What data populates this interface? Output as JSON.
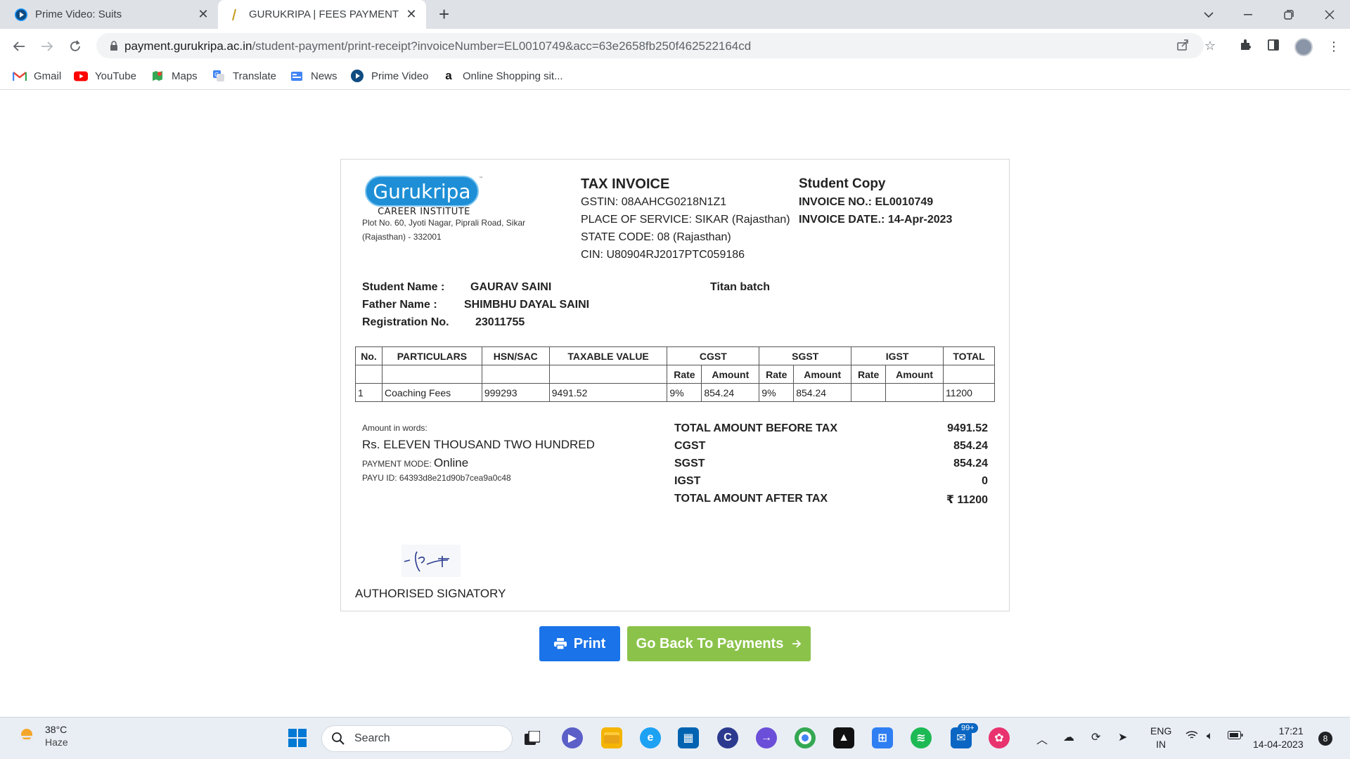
{
  "tabs": [
    {
      "title": "Prime Video: Suits"
    },
    {
      "title": "GURUKRIPA | FEES PAYMENT"
    }
  ],
  "address_bar": {
    "host": "payment.gurukripa.ac.in",
    "path": "/student-payment/print-receipt?invoiceNumber=EL0010749&acc=63e2658fb250f462522164cd"
  },
  "bookmarks": [
    {
      "label": "Gmail",
      "icon": "gmail-icon"
    },
    {
      "label": "YouTube",
      "icon": "youtube-icon"
    },
    {
      "label": "Maps",
      "icon": "maps-icon"
    },
    {
      "label": "Translate",
      "icon": "translate-icon"
    },
    {
      "label": "News",
      "icon": "news-icon"
    },
    {
      "label": "Prime Video",
      "icon": "prime-video-icon"
    },
    {
      "label": "Online Shopping sit...",
      "icon": "amazon-icon"
    }
  ],
  "invoice": {
    "logo": {
      "name": "Gurukripa",
      "tagline": "CAREER INSTITUTE",
      "tm": "™"
    },
    "address_line1": "Plot No. 60, Jyoti Nagar, Piprali Road, Sikar",
    "address_line2": "(Rajasthan) - 332001",
    "title": "TAX INVOICE",
    "gstin": "GSTIN: 08AAHCG0218N1Z1",
    "place_of_service": "PLACE OF SERVICE: SIKAR (Rajasthan)",
    "state_code": "STATE CODE: 08 (Rajasthan)",
    "cin": "CIN: U80904RJ2017PTC059186",
    "copy_label": "Student Copy",
    "invoice_no": "INVOICE NO.: EL0010749",
    "invoice_date": "INVOICE DATE.: 14-Apr-2023",
    "student_name_label": "Student Name :",
    "student_name": "GAURAV SAINI",
    "batch": "Titan batch",
    "father_name_label": "Father Name :",
    "father_name": "SHIMBHU DAYAL SAINI",
    "registration_label": "Registration No.",
    "registration_no": "23011755",
    "table": {
      "headers": {
        "no": "No.",
        "particulars": "PARTICULARS",
        "hsn": "HSN/SAC",
        "taxable": "TAXABLE VALUE",
        "cgst": "CGST",
        "sgst": "SGST",
        "igst": "IGST",
        "total": "TOTAL",
        "rate": "Rate",
        "amount": "Amount"
      },
      "row": {
        "no": "1",
        "particulars": "Coaching Fees",
        "hsn": "999293",
        "taxable": "9491.52",
        "cgst_rate": "9%",
        "cgst_amount": "854.24",
        "sgst_rate": "9%",
        "sgst_amount": "854.24",
        "igst_rate": "",
        "igst_amount": "",
        "total": "11200"
      }
    },
    "amount_in_words_label": "Amount in words:",
    "amount_in_words": "Rs. ELEVEN THOUSAND TWO HUNDRED",
    "payment_mode_label": "PAYMENT MODE:",
    "payment_mode": "Online",
    "payu_id": "PAYU ID: 64393d8e21d90b7cea9a0c48",
    "totals": [
      {
        "label": "TOTAL AMOUNT BEFORE TAX",
        "value": "9491.52"
      },
      {
        "label": "CGST",
        "value": "854.24"
      },
      {
        "label": "SGST",
        "value": "854.24"
      },
      {
        "label": "IGST",
        "value": "0"
      },
      {
        "label": "TOTAL AMOUNT AFTER TAX",
        "value": "₹ 11200"
      }
    ],
    "signatory": "AUTHORISED SIGNATORY"
  },
  "buttons": {
    "print": "Print",
    "back": "Go Back To Payments"
  },
  "taskbar": {
    "temperature": "38°C",
    "weather": "Haze",
    "search_placeholder": "Search",
    "badge": "99+",
    "lang_top": "ENG",
    "lang_bottom": "IN",
    "time": "17:21",
    "date": "14-04-2023",
    "notifications": "8"
  },
  "colors": {
    "print_button": "#1a73e8",
    "back_button": "#8bc34a",
    "logo_blue": "#1e8fd6"
  }
}
